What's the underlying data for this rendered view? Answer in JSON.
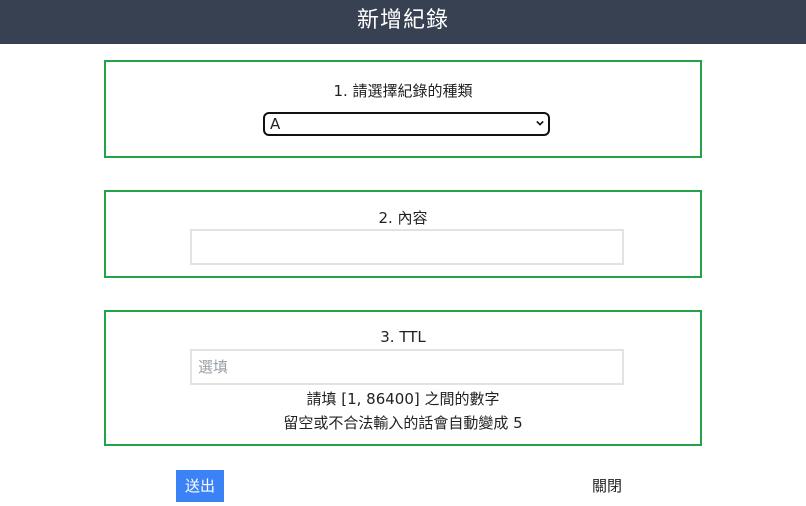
{
  "header": {
    "title": "新增紀錄"
  },
  "type_section": {
    "label": "1. 請選擇紀錄的種類",
    "selected": "A"
  },
  "content_section": {
    "label": "2. 內容",
    "value": ""
  },
  "ttl_section": {
    "label": "3. TTL",
    "placeholder": "選填",
    "hint_range": "請填 [1, 86400] 之間的數字",
    "hint_default": "留空或不合法輸入的話會自動變成 5"
  },
  "actions": {
    "submit_label": "送出",
    "close_label": "關閉"
  },
  "colors": {
    "header_bg": "#374151",
    "section_border": "#22a34a",
    "submit_bg": "#3b82f6"
  }
}
